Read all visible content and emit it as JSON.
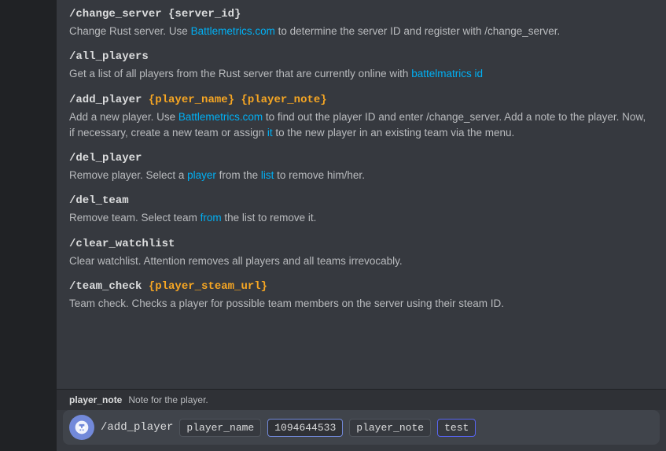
{
  "colors": {
    "bg_main": "#2f3136",
    "bg_content": "#36393f",
    "bg_input": "#40444b",
    "bg_dark": "#202225",
    "text_primary": "#dcddde",
    "text_secondary": "#b9bbbe",
    "accent": "#7289da",
    "link": "#00b0f4",
    "orange": "#f6a623",
    "border": "#4f545c"
  },
  "sidebar": {
    "visible": true
  },
  "commands": [
    {
      "id": "change_server",
      "title": "/change_server {server_id}",
      "description": "Change Rust server. Use Battlemetrics.com to determine the server ID and register with /change_server."
    },
    {
      "id": "all_players",
      "title": "/all_players",
      "description": "Get a list of all players from the Rust server that are currently online with battelmatrics id"
    },
    {
      "id": "add_player",
      "title": "/add_player {player_name} {player_note}",
      "description": "Add a new player. Use Battlemetrics.com to find out the player ID and enter /change_server. Add a note to the player. Now, if necessary, create a new team or assign it to the new player in an existing team via the menu."
    },
    {
      "id": "del_player",
      "title": "/del_player",
      "description": "Remove player. Select a player from the list to remove him/her."
    },
    {
      "id": "del_team",
      "title": "/del_team",
      "description": "Remove team. Select team from the list to remove it."
    },
    {
      "id": "clear_watchlist",
      "title": "/clear_watchlist",
      "description": "Clear watchlist. Attention removes all players and all teams irrevocably."
    },
    {
      "id": "team_check",
      "title": "/team_check {player_steam_url}",
      "description": "Team check. Checks a player for possible team members on the server using their steam ID."
    }
  ],
  "status_bar": {
    "label": "player_note",
    "description": "Note for the player."
  },
  "input_bar": {
    "prefix": "/add_player",
    "player_name_label": "player_name",
    "player_name_value": "1094644533",
    "player_note_label": "player_note",
    "player_note_value": "test"
  },
  "bot_avatar_letter": "🤖"
}
